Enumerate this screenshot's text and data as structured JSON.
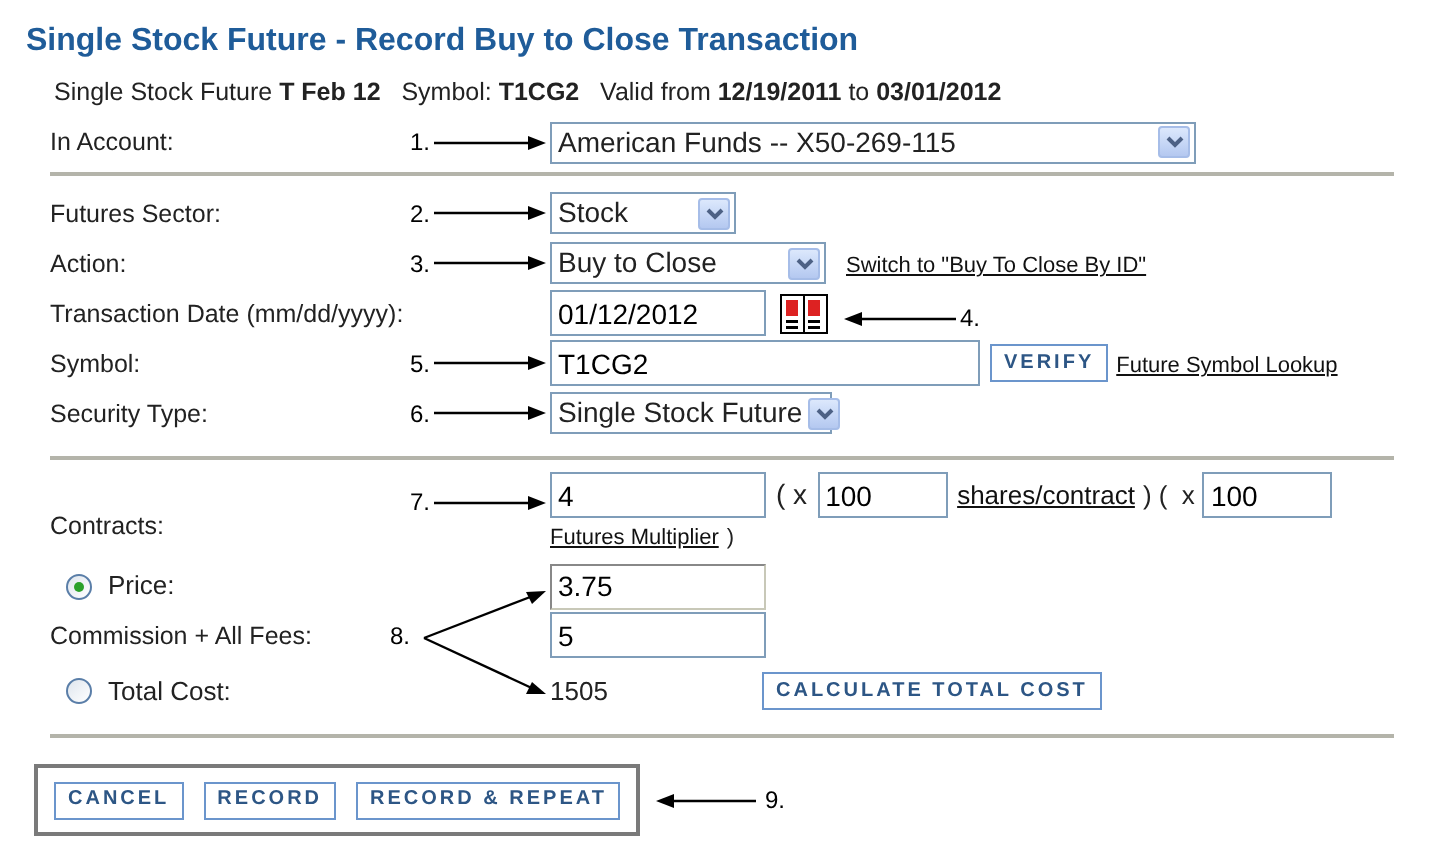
{
  "title": "Single Stock Future - Record Buy to Close Transaction",
  "summary": "Single Stock Future **T Feb 12**   Symbol: **T1CG2**   Valid from **12/19/2011** to **03/01/2012**",
  "account": {
    "label": "In Account:",
    "marker": "1.",
    "value": "American Funds -- X50-269-115"
  },
  "futures_sector": {
    "label": "Futures Sector:",
    "marker": "2.",
    "value": "Stock"
  },
  "action": {
    "label": "Action:",
    "marker": "3.",
    "value": "Buy to Close",
    "link": "Switch to \"Buy To Close By ID\""
  },
  "transaction_date": {
    "label": "Transaction Date (mm/dd/yyyy):",
    "value": "01/12/2012",
    "marker": "4."
  },
  "symbol": {
    "label": "Symbol:",
    "marker": "5.",
    "value": "T1CG2",
    "verify_button": "VERIFY",
    "link": "Future Symbol Lookup"
  },
  "security_type": {
    "label": "Security Type:",
    "marker": "6.",
    "value": "Single Stock Future"
  },
  "contracts": {
    "label": "Contracts:",
    "marker": "7.",
    "value": "4",
    "open_paren": "( x",
    "shares_per_contract": "100",
    "shares_link": "shares/contract",
    "middle": ") (  x",
    "multiplier": "100",
    "multiplier_link": "Futures Multiplier",
    "close_paren": ")"
  },
  "price": {
    "label": "Price:",
    "selected": true,
    "value": "3.75"
  },
  "commission": {
    "label": "Commission + All Fees:",
    "value": "5"
  },
  "total_cost": {
    "label": "Total Cost:",
    "selected": false,
    "value": "1505",
    "calculate_button": "CALCULATE TOTAL COST"
  },
  "cost_marker": "8.",
  "buttons": [
    "CANCEL",
    "RECORD",
    "RECORD & REPEAT"
  ],
  "buttons_marker": "9."
}
